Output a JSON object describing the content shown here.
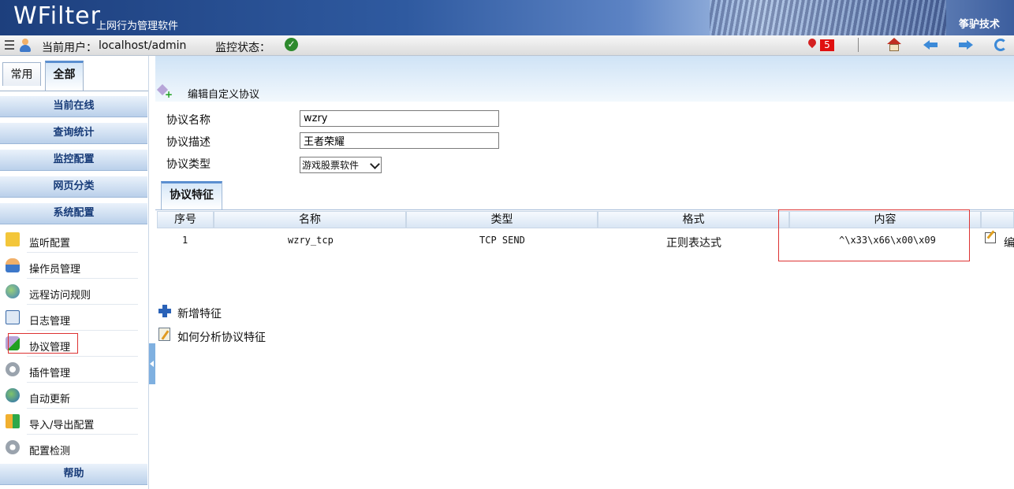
{
  "banner": {
    "logo": "WFilter",
    "subtitle": "上网行为管理软件",
    "company": "筝驴技术"
  },
  "status": {
    "current_user_label": "当前用户：",
    "current_user": "localhost/admin",
    "monitor_label": "监控状态：",
    "alert_count": "5"
  },
  "sidebar": {
    "tabs": [
      "常用",
      "全部"
    ],
    "active_tab": "全部",
    "sections": [
      "当前在线",
      "查询统计",
      "监控配置",
      "网页分类",
      "系统配置"
    ],
    "items": [
      {
        "label": "监听配置",
        "icon": "warning-icon"
      },
      {
        "label": "操作员管理",
        "icon": "user-icon"
      },
      {
        "label": "远程访问规则",
        "icon": "globe-icon"
      },
      {
        "label": "日志管理",
        "icon": "log-icon"
      },
      {
        "label": "协议管理",
        "icon": "protocol-icon"
      },
      {
        "label": "插件管理",
        "icon": "plugin-gear-icon"
      },
      {
        "label": "自动更新",
        "icon": "update-globe-icon"
      },
      {
        "label": "导入/导出配置",
        "icon": "import-export-icon"
      },
      {
        "label": "配置检测",
        "icon": "check-gear-icon"
      }
    ],
    "help_section": "帮助"
  },
  "main": {
    "title": "编辑自定义协议",
    "form": {
      "name_label": "协议名称",
      "name_value": "wzry",
      "desc_label": "协议描述",
      "desc_value": "王者荣耀",
      "type_label": "协议类型",
      "type_value": "游戏股票软件"
    },
    "feature_tab": "协议特征",
    "table": {
      "headers": [
        "序号",
        "名称",
        "类型",
        "格式",
        "内容"
      ],
      "rows": [
        {
          "index": "1",
          "name": "wzry_tcp",
          "type": "TCP SEND",
          "format": "正则表达式",
          "content": "^\\x33\\x66\\x00\\x09",
          "action": "编"
        }
      ]
    },
    "add_feature": "新增特征",
    "how_to_analyze": "如何分析协议特征"
  },
  "colors": {
    "banner": "#2f5aa0",
    "section_text": "#173b78",
    "highlight": "#dd3333",
    "alert": "#e01010"
  }
}
